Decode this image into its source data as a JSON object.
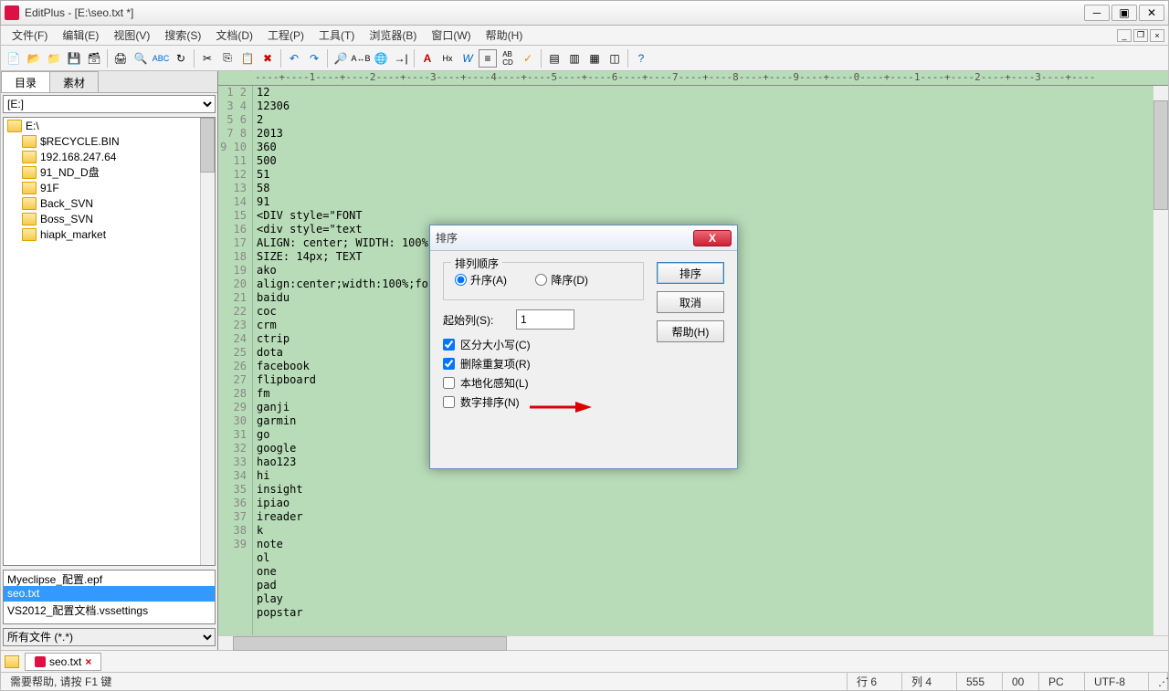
{
  "app": {
    "title": "EditPlus - [E:\\seo.txt *]"
  },
  "menu": [
    "文件(F)",
    "编辑(E)",
    "视图(V)",
    "搜索(S)",
    "文档(D)",
    "工程(P)",
    "工具(T)",
    "浏览器(B)",
    "窗口(W)",
    "帮助(H)"
  ],
  "sidebar": {
    "tabs": [
      "目录",
      "素材"
    ],
    "drive": "[E:]",
    "tree_root": "E:\\",
    "tree": [
      "$RECYCLE.BIN",
      "192.168.247.64",
      "91_ND_D盘",
      "91F",
      "Back_SVN",
      "Boss_SVN",
      "hiapk_market"
    ],
    "files": [
      "Myeclipse_配置.epf",
      "seo.txt",
      "VS2012_配置文档.vssettings"
    ],
    "files_selected": 1,
    "filter": "所有文件 (*.*)"
  },
  "ruler": "----+----1----+----2----+----3----+----4----+----5----+----6----+----7----+----8----+----9----+----0----+----1----+----2----+----3----+----",
  "code": {
    "start": 1,
    "lines": [
      "12",
      "12306",
      "2",
      "2013",
      "360",
      "500",
      "51",
      "58",
      "91",
      "<DIV style=\"FONT",
      "<div style=\"text",
      "ALIGN: center; WIDTH: 100%",
      "SIZE: 14px; TEXT",
      "ako",
      "align:center;width:100%;fo",
      "baidu",
      "coc",
      "crm",
      "ctrip",
      "dota",
      "facebook",
      "flipboard",
      "fm",
      "ganji",
      "garmin",
      "go",
      "google",
      "hao123",
      "hi",
      "insight",
      "ipiao",
      "ireader",
      "k",
      "note",
      "ol",
      "one",
      "pad",
      "play",
      "popstar"
    ]
  },
  "doctab": {
    "label": "seo.txt"
  },
  "status": {
    "help": "需要帮助, 请按 F1 键",
    "line": "行 6",
    "col": "列 4",
    "total": "555",
    "zero": "00",
    "mode": "PC",
    "enc": "UTF-8"
  },
  "dialog": {
    "title": "排序",
    "group_title": "排列顺序",
    "asc": "升序(A)",
    "desc": "降序(D)",
    "startcol_label": "起始列(S):",
    "startcol_value": "1",
    "case": "区分大小写(C)",
    "dup": "删除重复项(R)",
    "locale": "本地化感知(L)",
    "numeric": "数字排序(N)",
    "btn_sort": "排序",
    "btn_cancel": "取消",
    "btn_help": "帮助(H)"
  }
}
